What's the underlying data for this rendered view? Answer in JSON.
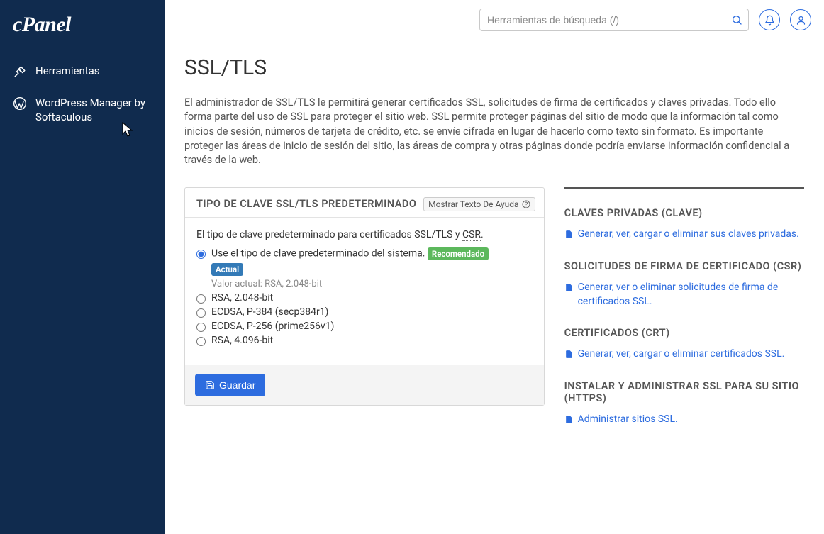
{
  "brand": "cPanel",
  "sidebar": {
    "items": [
      {
        "label": "Herramientas"
      },
      {
        "label": "WordPress Manager by Softaculous"
      }
    ]
  },
  "header": {
    "search_placeholder": "Herramientas de búsqueda (/)"
  },
  "page": {
    "title": "SSL/TLS",
    "intro": "El administrador de SSL/TLS le permitirá generar certificados SSL, solicitudes de firma de certificados y claves privadas. Todo ello forma parte del uso de SSL para proteger el sitio web. SSL permite proteger páginas del sitio de modo que la información tal como inicios de sesión, números de tarjeta de crédito, etc. se envíe cifrada en lugar de hacerlo como texto sin formato. Es importante proteger las áreas de inicio de sesión del sitio, las áreas de compra y otras páginas donde podría enviarse información confidencial a través de la web."
  },
  "panel": {
    "title": "TIPO DE CLAVE SSL/TLS PREDETERMINADO",
    "help_toggle": "Mostrar Texto De Ayuda",
    "desc_prefix": "El tipo de clave predeterminado para certificados SSL/TLS y ",
    "desc_abbr": "CSR",
    "desc_suffix": ".",
    "options": [
      {
        "label": "Use el tipo de clave predeterminado del sistema.",
        "recommended": "Recomendado",
        "current": "Actual",
        "current_note": "Valor actual: RSA, 2.048-bit",
        "checked": true
      },
      {
        "label": "RSA, 2.048-bit"
      },
      {
        "label": "ECDSA, P-384 (secp384r1)"
      },
      {
        "label": "ECDSA, P-256 (prime256v1)"
      },
      {
        "label": "RSA, 4.096-bit"
      }
    ],
    "save_label": "Guardar"
  },
  "right": {
    "sections": [
      {
        "title": "CLAVES PRIVADAS (CLAVE)",
        "link": "Generar, ver, cargar o eliminar sus claves privadas."
      },
      {
        "title": "SOLICITUDES DE FIRMA DE CERTIFICADO (CSR)",
        "link": "Generar, ver o eliminar solicitudes de firma de certificados SSL."
      },
      {
        "title": "CERTIFICADOS (CRT)",
        "link": "Generar, ver, cargar o eliminar certificados SSL."
      },
      {
        "title": "INSTALAR Y ADMINISTRAR SSL PARA SU SITIO (HTTPS)",
        "link": "Administrar sitios SSL."
      }
    ]
  }
}
